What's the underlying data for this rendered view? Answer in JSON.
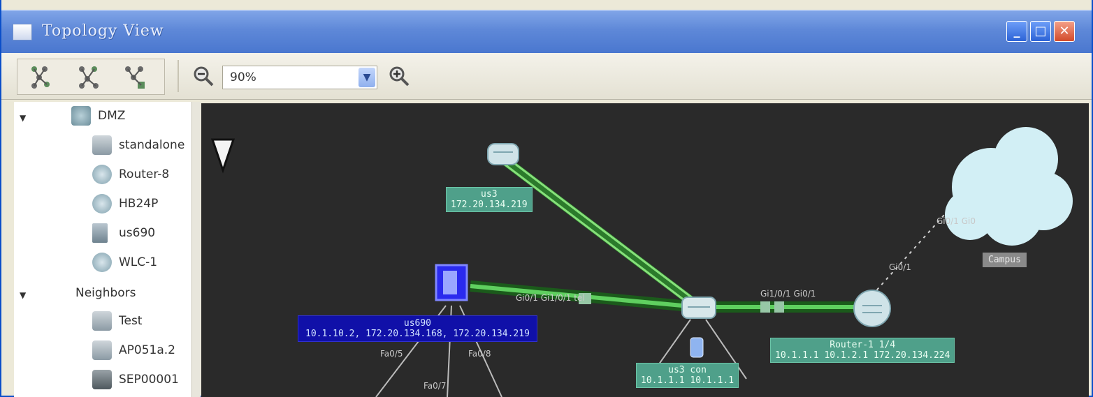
{
  "window": {
    "title": "Topology View"
  },
  "toolbar": {
    "zoom_value": "90%"
  },
  "tree": {
    "groups": [
      {
        "label": "DMZ",
        "children": [
          "standalone",
          "Router-8",
          "HB24P",
          "us690",
          "WLC-1"
        ]
      },
      {
        "label": "Neighbors",
        "children": [
          "Test",
          "AP051a.2",
          "SEP00001"
        ]
      }
    ]
  },
  "topology": {
    "nodes": {
      "top_switch": {
        "name": "us3",
        "ip": "172.20.134.219"
      },
      "center_device": {
        "name": "us690",
        "ips": "10.1.10.2, 172.20.134.168, 172.20.134.219"
      },
      "bottom_switch": {
        "name": "us3 con",
        "ip": "10.1.1.1 10.1.1.1"
      },
      "router": {
        "name": "Router-1 1/4",
        "ips": "10.1.1.1 10.1.2.1 172.20.134.224"
      },
      "cloud_label": "Campus"
    },
    "links": {
      "center_to_switch": "Gi0/1 Gi1/0/1 tel",
      "switch_to_router": "Gi1/0/1 Gi0/1",
      "router_to_cloud_a": "Gi0/1 Gi0",
      "router_to_cloud_b": "Gi0/1",
      "port_fa0_5": "Fa0/5",
      "port_fa0_7": "Fa0/7",
      "port_fa0_8": "Fa0/8"
    }
  },
  "colors": {
    "titlebar": "#4a77cf",
    "canvas_bg": "#2a2a2a",
    "link_green": "#4cc94c",
    "label_green": "#4fa08a",
    "selected_blue": "#1010a8"
  }
}
